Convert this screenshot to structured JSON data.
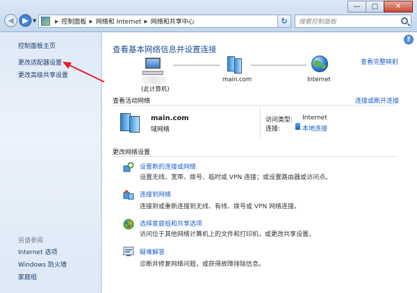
{
  "window": {
    "minimize": "—",
    "maximize": "□",
    "close": "✕"
  },
  "address": {
    "crumbs": [
      "控制面板",
      "网络和 Internet",
      "网络和共享中心"
    ],
    "search_placeholder": "搜索控制面板"
  },
  "sidebar": {
    "links": [
      "控制面板主页",
      "更改适配器设置",
      "更改高级共享设置"
    ],
    "see_also_title": "另请参阅",
    "see_also": [
      "Internet 选项",
      "Windows 防火墙",
      "家庭组"
    ]
  },
  "main": {
    "heading": "查看基本网络信息并设置连接",
    "full_map": "查看完整映射",
    "map": {
      "computer": "(此计算机)",
      "domain": "main.com",
      "internet": "Internet"
    },
    "active_title": "查看活动网络",
    "connect_link": "连接或断开连接",
    "network": {
      "name": "main.com",
      "type": "域网络",
      "access_label": "访问类型:",
      "access_value": "Internet",
      "conn_label": "连接:",
      "conn_value": "本地连接"
    },
    "change_title": "更改网络设置",
    "tasks": [
      {
        "title": "设置新的连接或网络",
        "desc": "设置无线、宽带、拨号、临时或 VPN 连接；或设置路由器或访问点。"
      },
      {
        "title": "连接到网络",
        "desc": "连接到或重新连接到无线、有线、拨号或 VPN 网络连接。"
      },
      {
        "title": "选择家庭组和共享选项",
        "desc": "访问位于其他网络计算机上的文件和打印机，或更改共享设置。"
      },
      {
        "title": "疑难解答",
        "desc": "诊断并修复网络问题，或获得故障排除信息。"
      }
    ]
  },
  "colors": {
    "annotation_arrow": "#e02020",
    "link": "#1c5fc5",
    "heading": "#1a4c99"
  }
}
